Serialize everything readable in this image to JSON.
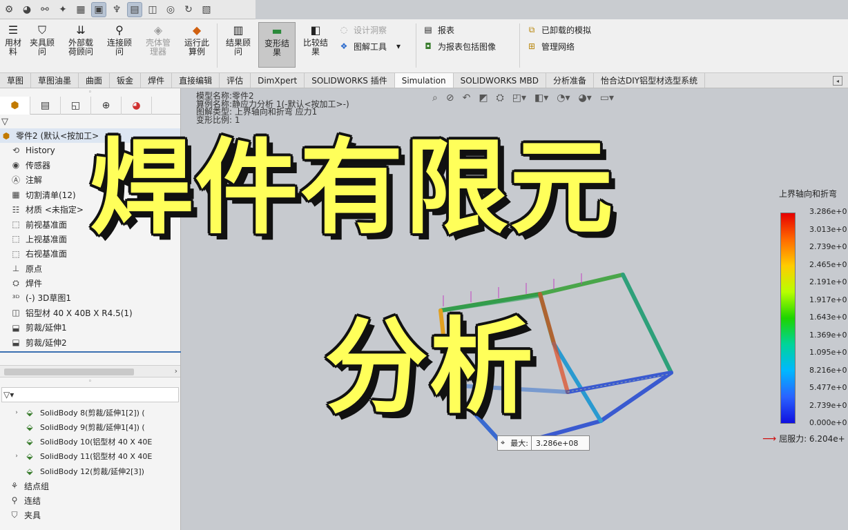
{
  "ribbon": {
    "buttons": [
      {
        "label": "用材\n料",
        "disabled": false
      },
      {
        "label": "夹具顾\n问",
        "disabled": false
      },
      {
        "label": "外部载\n荷顾问",
        "disabled": false
      },
      {
        "label": "连接顾\n问",
        "disabled": false
      },
      {
        "label": "壳体管\n理器",
        "disabled": true
      },
      {
        "label": "运行此\n算例",
        "disabled": false
      },
      {
        "label": "结果顾\n问",
        "disabled": false
      },
      {
        "label": "变形结\n果",
        "disabled": false,
        "pressed": true
      },
      {
        "label": "比较结\n果",
        "disabled": false
      }
    ],
    "small": {
      "design_insight": "设计洞察",
      "plot_tools": "图解工具",
      "report": "报表",
      "include_image": "为报表包括图像",
      "unloaded": "已卸载的模拟",
      "manage_network": "管理网络"
    }
  },
  "tabs": [
    "草图",
    "草图油墨",
    "曲面",
    "钣金",
    "焊件",
    "直接编辑",
    "评估",
    "DimXpert",
    "SOLIDWORKS 插件",
    "Simulation",
    "SOLIDWORKS MBD",
    "分析准备",
    "怡合达DIY铝型材选型系统"
  ],
  "active_tab": "Simulation",
  "tree": {
    "root": "零件2 (默认<按加工>",
    "items": [
      {
        "icon": "history-icon",
        "label": "History"
      },
      {
        "icon": "sensor-icon",
        "label": "传感器"
      },
      {
        "icon": "annotation-icon",
        "label": "注解"
      },
      {
        "icon": "cut-list-icon",
        "label": "切割清单(12)"
      },
      {
        "icon": "material-icon",
        "label": "材质 <未指定>"
      },
      {
        "icon": "plane-icon",
        "label": "前视基准面"
      },
      {
        "icon": "plane-icon",
        "label": "上视基准面"
      },
      {
        "icon": "plane-icon",
        "label": "右视基准面"
      },
      {
        "icon": "origin-icon",
        "label": "原点"
      },
      {
        "icon": "weldment-icon",
        "label": "焊件"
      },
      {
        "icon": "sketch3d-icon",
        "label": "(-) 3D草图1"
      },
      {
        "icon": "structural-member-icon",
        "label": "铝型材 40 X 40B X R4.5(1)"
      },
      {
        "icon": "trim-icon",
        "label": "剪裁/延伸1"
      },
      {
        "icon": "trim-icon",
        "label": "剪裁/延伸2"
      }
    ]
  },
  "bodies": {
    "items": [
      {
        "expandable": true,
        "label": "SolidBody 8(剪裁/延伸1[2]) ("
      },
      {
        "expandable": false,
        "label": "SolidBody 9(剪裁/延伸1[4]) ("
      },
      {
        "expandable": false,
        "label": "SolidBody 10(铝型材 40 X 40E"
      },
      {
        "expandable": true,
        "label": "SolidBody 11(铝型材 40 X 40E"
      },
      {
        "expandable": false,
        "label": "SolidBody 12(剪裁/延伸2[3])"
      }
    ],
    "groups": [
      {
        "icon": "joint-group-icon",
        "label": "结点组"
      },
      {
        "icon": "connection-icon",
        "label": "连结"
      },
      {
        "icon": "fixture-icon",
        "label": "夹具"
      }
    ]
  },
  "viewport": {
    "meta": [
      "模型名称:零件2",
      "算例名称:静应力分析 1(-默认<按加工>-)",
      "图解类型: 上界轴向和折弯 应力1",
      "变形比例: 1"
    ],
    "legend_title": "上界轴向和折弯",
    "legend_ticks": [
      "3.286e+0",
      "3.013e+0",
      "2.739e+0",
      "2.465e+0",
      "2.191e+0",
      "1.917e+0",
      "1.643e+0",
      "1.369e+0",
      "1.095e+0",
      "8.216e+0",
      "5.477e+0",
      "2.739e+0",
      "0.000e+0"
    ],
    "yield": "屈服力: 6.204e+",
    "max_label": "最大:",
    "max_value": "3.286e+08"
  },
  "overlay": {
    "line1": "焊件有限元",
    "line2": "分析"
  }
}
